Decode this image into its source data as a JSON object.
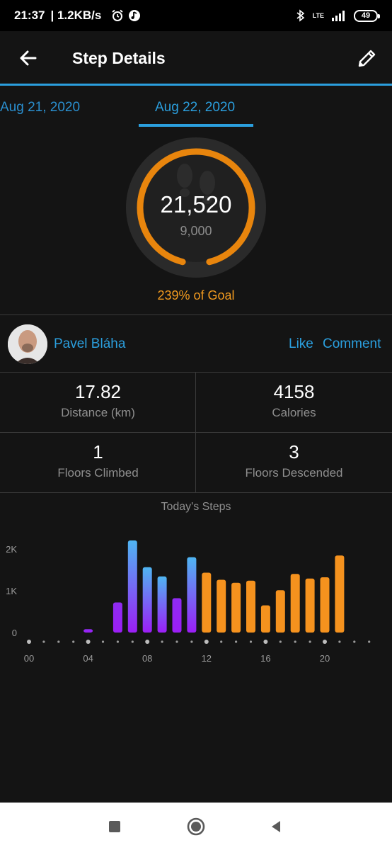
{
  "status_bar": {
    "time": "21:37",
    "speed": "| 1.2KB/s",
    "network": "LTE",
    "battery": "49",
    "icons": [
      "alarm-icon",
      "music-icon",
      "bluetooth-icon",
      "signal-icon"
    ]
  },
  "header": {
    "title": "Step Details",
    "back_icon": "back-arrow-icon",
    "edit_icon": "pencil-icon"
  },
  "date_tabs": {
    "previous": "Aug 21, 2020",
    "current": "Aug 22, 2020"
  },
  "steps": {
    "count": "21,520",
    "goal": "9,000",
    "percent_text": "239% of Goal"
  },
  "social": {
    "user_name": "Pavel Bláha",
    "like_label": "Like",
    "comment_label": "Comment"
  },
  "stats": {
    "distance_value": "17.82",
    "distance_label": "Distance (km)",
    "calories_value": "4158",
    "calories_label": "Calories",
    "floors_climbed_value": "1",
    "floors_climbed_label": "Floors Climbed",
    "floors_descended_value": "3",
    "floors_descended_label": "Floors Descended"
  },
  "colors": {
    "accent_blue": "#2b9fde",
    "ring_orange": "#f29a1f",
    "bar_orange": "#f5921e",
    "bar_purple": "#9b1ef5",
    "bar_blue": "#4fb5f2"
  },
  "chart_data": {
    "type": "bar",
    "title": "Today's Steps",
    "xlabel": "",
    "ylabel": "",
    "ylim": [
      0,
      2200
    ],
    "yticks": [
      "0",
      "1K",
      "2K"
    ],
    "x_tick_labels": [
      "00",
      "04",
      "08",
      "12",
      "16",
      "20"
    ],
    "series": [
      {
        "values": [
          0,
          0,
          0,
          0,
          80,
          0,
          720,
          2200,
          1560,
          1340,
          820,
          1800,
          1430,
          1260,
          1190,
          1240,
          650,
          1010,
          1400,
          1290,
          1320,
          1840
        ],
        "colors": [
          "purple",
          "purple",
          "purple",
          "purple",
          "purple",
          "purple",
          "purple",
          "blue",
          "blue",
          "blue",
          "purple",
          "blue",
          "orange",
          "orange",
          "orange",
          "orange",
          "orange",
          "orange",
          "orange",
          "orange",
          "orange",
          "orange"
        ]
      }
    ],
    "categories": [
      "00",
      "01",
      "02",
      "03",
      "04",
      "05",
      "06",
      "07",
      "08",
      "09",
      "10",
      "11",
      "12",
      "13",
      "14",
      "15",
      "16",
      "17",
      "18",
      "19",
      "20",
      "21"
    ]
  },
  "nav": {
    "recent_icon": "square-recents-icon",
    "home_icon": "circle-home-icon",
    "back_icon": "triangle-back-icon"
  }
}
